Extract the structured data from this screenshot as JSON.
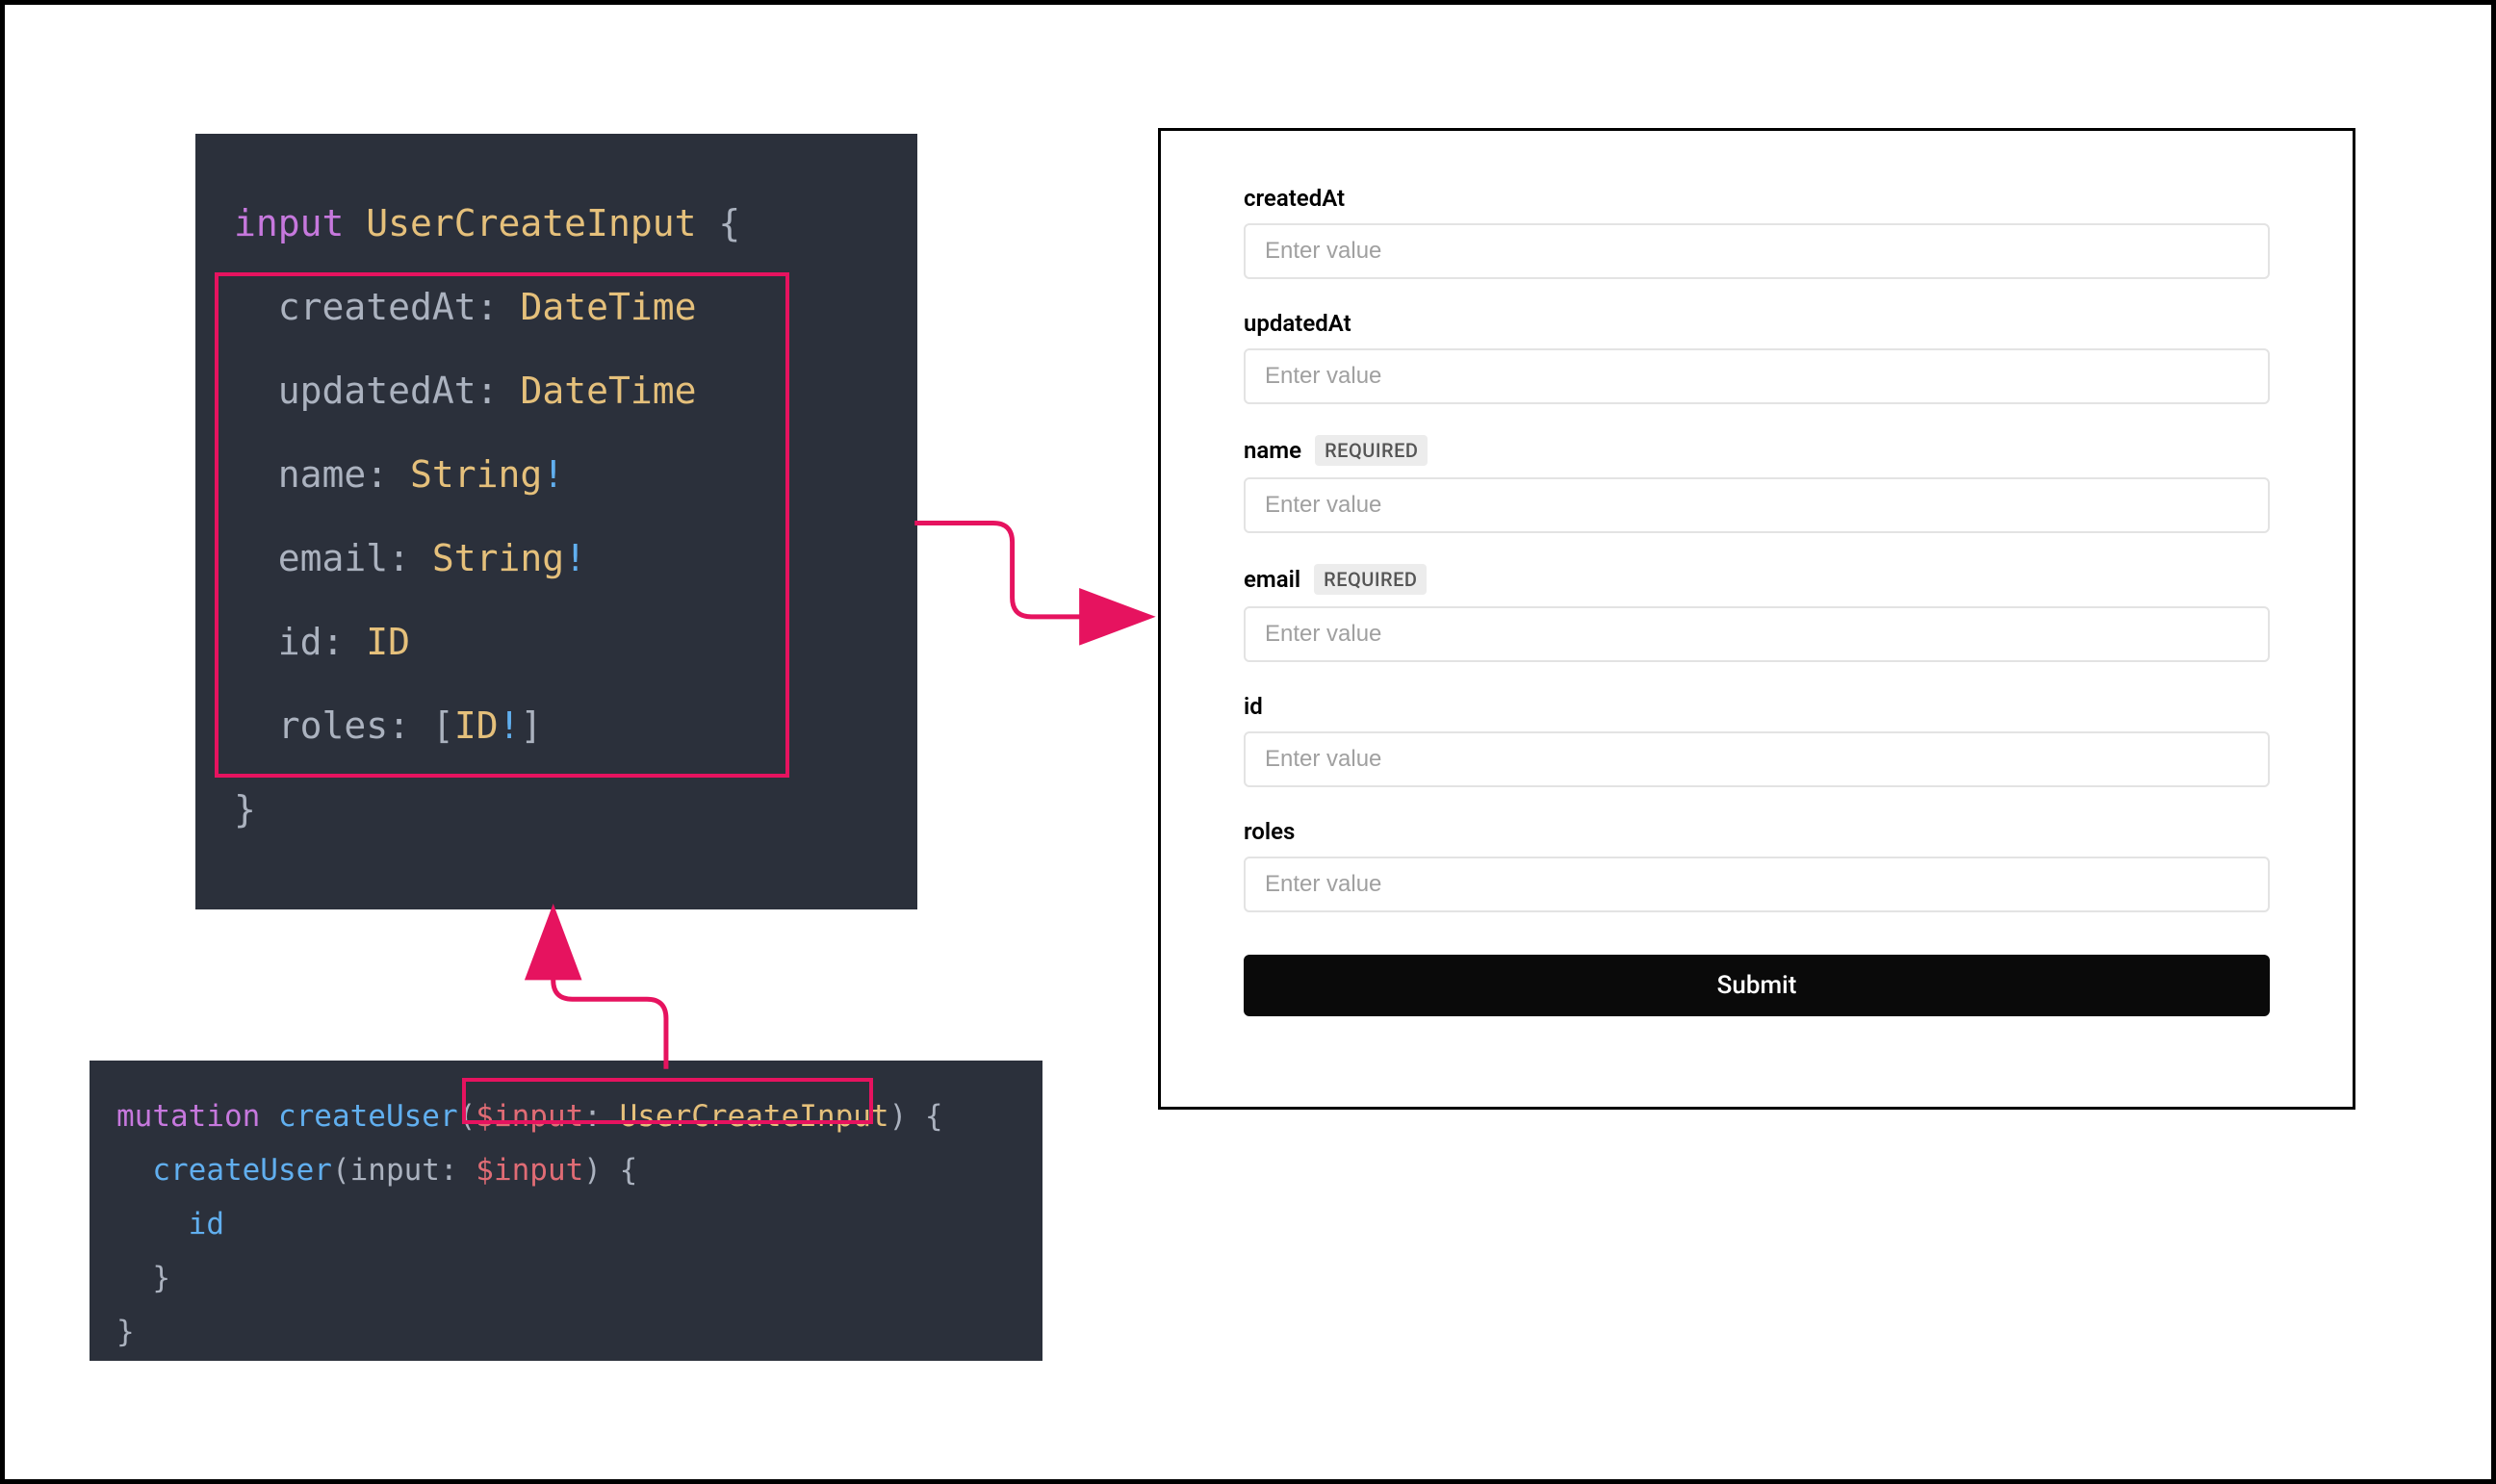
{
  "code_input_type": {
    "keyword": "input",
    "type_name": "UserCreateInput",
    "open": " {",
    "fields": [
      {
        "name": "createdAt",
        "type": "DateTime",
        "required": false,
        "list": false
      },
      {
        "name": "updatedAt",
        "type": "DateTime",
        "required": false,
        "list": false
      },
      {
        "name": "name",
        "type": "String",
        "required": true,
        "list": false
      },
      {
        "name": "email",
        "type": "String",
        "required": true,
        "list": false
      },
      {
        "name": "id",
        "type": "ID",
        "required": false,
        "list": false
      },
      {
        "name": "roles",
        "type": "ID",
        "required": true,
        "list": true
      }
    ],
    "close": "}"
  },
  "code_mutation": {
    "tokens": {
      "kw": "mutation",
      "op_name": "createUser",
      "arg_decl_var": "$input",
      "arg_decl_type": "UserCreateInput",
      "call_name": "createUser",
      "call_arg_key": "input",
      "call_arg_val": "$input",
      "selection": "id"
    }
  },
  "form": {
    "required_badge": "REQUIRED",
    "placeholder": "Enter value",
    "fields": [
      {
        "label": "createdAt",
        "required": false
      },
      {
        "label": "updatedAt",
        "required": false
      },
      {
        "label": "name",
        "required": true
      },
      {
        "label": "email",
        "required": true
      },
      {
        "label": "id",
        "required": false
      },
      {
        "label": "roles",
        "required": false
      }
    ],
    "submit_label": "Submit"
  },
  "colors": {
    "accent": "#e6135f",
    "code_bg": "#2b303b"
  }
}
